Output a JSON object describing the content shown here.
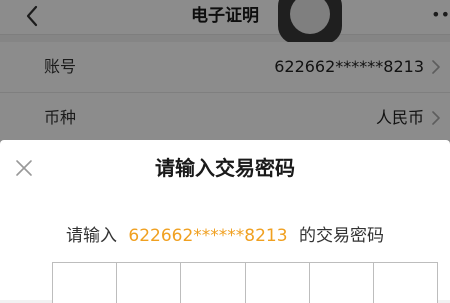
{
  "navbar": {
    "title": "电子证明",
    "back_icon": "chevron-left-icon",
    "more_text": "••"
  },
  "info": {
    "rows": [
      {
        "label": "账号",
        "value": "622662******8213"
      },
      {
        "label": "币种",
        "value": "人民币"
      }
    ]
  },
  "dialog": {
    "title": "请输入交易密码",
    "prompt_prefix": "请输入",
    "prompt_account": "622662******8213",
    "prompt_suffix": "的交易密码",
    "pin_length": 6,
    "close_icon": "close-icon"
  },
  "colors": {
    "accent": "#f0a020",
    "overlay": "rgba(0,0,0,0.45)",
    "float_ball": "#3a3a3a"
  }
}
